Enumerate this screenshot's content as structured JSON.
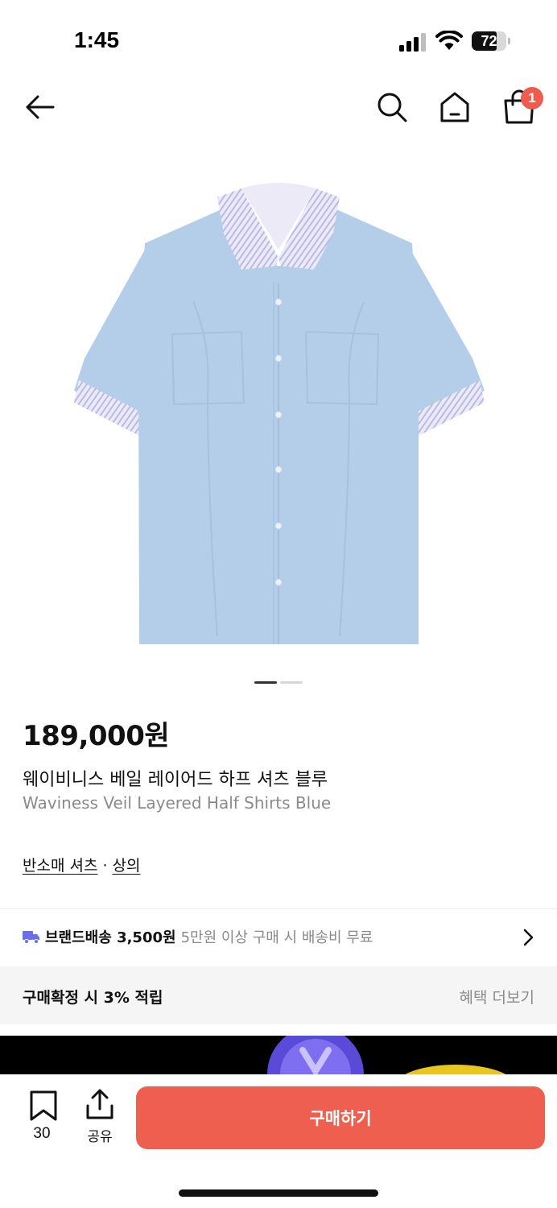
{
  "status_bar": {
    "time": "1:45",
    "battery": "72"
  },
  "nav": {
    "cart_badge": "1"
  },
  "product": {
    "price": "189,000원",
    "name_ko": "웨이비니스 베일 레이어드 하프 셔츠 블루",
    "name_en": "Waviness Veil Layered Half Shirts Blue",
    "category": [
      "반소매 셔츠",
      "상의"
    ],
    "category_separator": "·"
  },
  "shipping": {
    "label": "브랜드배송 3,500원",
    "note": "5만원 이상 구매 시 배송비 무료"
  },
  "benefit": {
    "title": "구매확정 시 3% 적립",
    "more": "혜택 더보기"
  },
  "bottom_bar": {
    "bookmark_count": "30",
    "share_label": "공유",
    "buy_label": "구매하기"
  },
  "colors": {
    "accent": "#ef5f50",
    "badge": "#ef5b4c",
    "shirt": "#b4cde8",
    "truck": "#6a6ee8"
  },
  "carousel": {
    "current": 1,
    "total": 2
  }
}
